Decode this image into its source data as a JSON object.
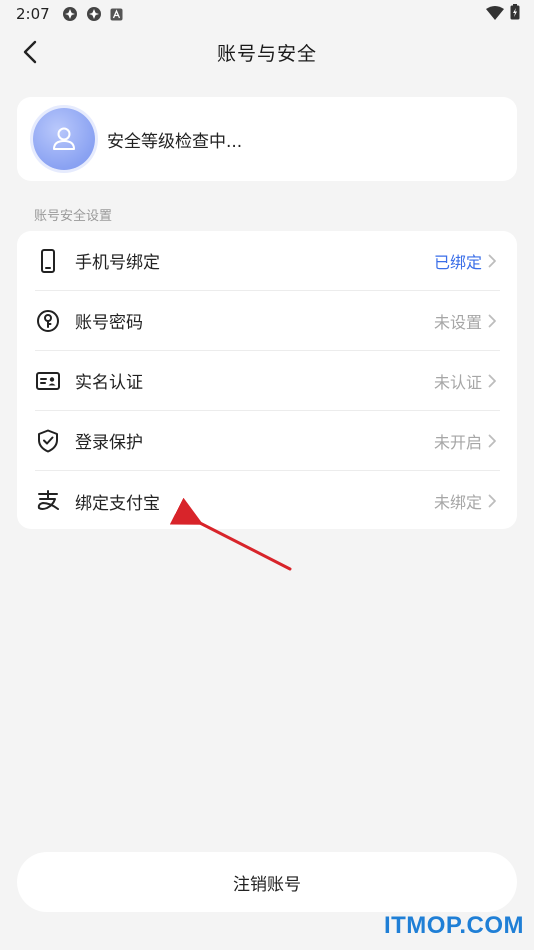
{
  "status_bar": {
    "time": "2:07",
    "icons": [
      "notification-app-icon",
      "notification-app-icon",
      "keyboard-notification-icon",
      "wifi-icon",
      "battery-charging-icon"
    ]
  },
  "nav": {
    "title": "账号与安全",
    "back_icon": "chevron-left-icon"
  },
  "security": {
    "status": "安全等级检查中..."
  },
  "section": {
    "label": "账号安全设置"
  },
  "settings": [
    {
      "icon": "phone-icon",
      "label": "手机号绑定",
      "value": "已绑定",
      "value_color": "#3a6ee8"
    },
    {
      "icon": "key-icon",
      "label": "账号密码",
      "value": "未设置",
      "value_color": "#a6a6a6"
    },
    {
      "icon": "id-card-icon",
      "label": "实名认证",
      "value": "未认证",
      "value_color": "#a6a6a6"
    },
    {
      "icon": "shield-check-icon",
      "label": "登录保护",
      "value": "未开启",
      "value_color": "#a6a6a6"
    },
    {
      "icon": "alipay-icon",
      "label": "绑定支付宝",
      "value": "未绑定",
      "value_color": "#a6a6a6"
    }
  ],
  "footer": {
    "deregister_label": "注销账号"
  },
  "watermark": {
    "text": "ITMOP.COM",
    "color": "#1f7fd6"
  },
  "annotation": {
    "arrow_color": "#d8242a"
  }
}
